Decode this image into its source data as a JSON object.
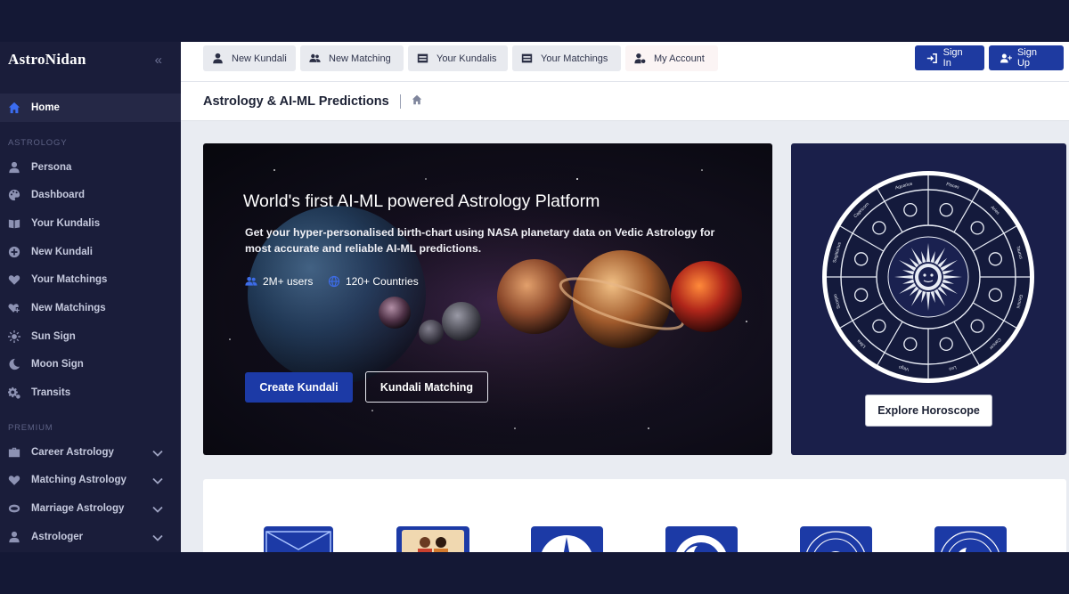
{
  "brand": {
    "name": "AstroNidan",
    "collapse_icon": "double-chevron-left-icon"
  },
  "sidebar": {
    "home": {
      "label": "Home",
      "icon": "home-icon"
    },
    "sections": [
      {
        "title": "ASTROLOGY",
        "items": [
          {
            "label": "Persona",
            "icon": "user-icon"
          },
          {
            "label": "Dashboard",
            "icon": "palette-icon"
          },
          {
            "label": "Your Kundalis",
            "icon": "book-icon"
          },
          {
            "label": "New Kundali",
            "icon": "plus-circle-icon"
          },
          {
            "label": "Your Matchings",
            "icon": "heart-icon"
          },
          {
            "label": "New Matchings",
            "icon": "heart-plus-icon"
          },
          {
            "label": "Sun Sign",
            "icon": "sun-icon"
          },
          {
            "label": "Moon Sign",
            "icon": "moon-icon"
          },
          {
            "label": "Transits",
            "icon": "gears-icon"
          }
        ]
      },
      {
        "title": "PREMIUM",
        "items": [
          {
            "label": "Career Astrology",
            "icon": "briefcase-icon",
            "expandable": true
          },
          {
            "label": "Matching Astrology",
            "icon": "heart-icon",
            "expandable": true
          },
          {
            "label": "Marriage Astrology",
            "icon": "ring-icon",
            "expandable": true
          },
          {
            "label": "Astrologer",
            "icon": "user-tie-icon",
            "expandable": true
          }
        ]
      }
    ]
  },
  "topbar": {
    "new_kundali": "New Kundali",
    "new_matching": "New Matching",
    "your_kundalis": "Your Kundalis",
    "your_matchings": "Your Matchings",
    "my_account": "My Account",
    "sign_in": "Sign In",
    "sign_up": "Sign Up"
  },
  "header": {
    "title": "Astrology & AI-ML Predictions",
    "breadcrumb_icon": "home-icon"
  },
  "hero": {
    "title": "World's first AI-ML powered Astrology Platform",
    "description": "Get your hyper-personalised birth-chart using NASA planetary data on Vedic Astrology for most accurate and reliable AI-ML predictions.",
    "stat_users": "2M+ users",
    "stat_countries": "120+ Countries",
    "create_kundali": "Create Kundali",
    "kundali_matching": "Kundali Matching"
  },
  "zodiac": {
    "explore": "Explore Horoscope",
    "signs": [
      "Pisces",
      "Aries",
      "Taurus",
      "Gemini",
      "Cancer",
      "Leo",
      "Virgo",
      "Libra",
      "Scorpio",
      "Sagittarius",
      "Capricorn",
      "Aquarius"
    ]
  },
  "features": {
    "tiles": [
      "kundali-envelope",
      "matching-couple",
      "compass-chart",
      "moon-sign",
      "sun-zodiac",
      "moon-zodiac"
    ]
  },
  "colors": {
    "accent": "#1c3aa6",
    "sidebar": "#1a1d3a",
    "zodiac_bg": "#1a1f4a"
  }
}
